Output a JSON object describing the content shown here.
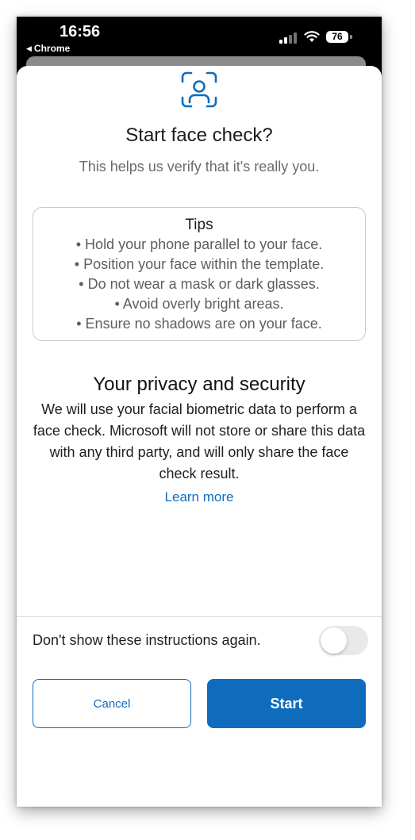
{
  "status_bar": {
    "time": "16:56",
    "back_app": "Chrome",
    "battery": "76",
    "icons": [
      "signal-icon",
      "wifi-icon",
      "battery-icon"
    ]
  },
  "dialog": {
    "icon": "face-scan-icon",
    "title": "Start face check?",
    "subtitle": "This helps us verify that it's really you.",
    "tips": {
      "title": "Tips",
      "items": [
        "• Hold your phone parallel to your face.",
        "• Position your face within the template.",
        "• Do not wear a mask or dark glasses.",
        "• Avoid overly bright areas.",
        "• Ensure no shadows are on your face."
      ]
    },
    "privacy": {
      "title": "Your privacy and security",
      "body": "We will use your facial biometric data to perform a face check. Microsoft will not store or share this data with any third party, and will only share the face check result.",
      "link": "Learn more"
    },
    "toggle": {
      "label": "Don't show these instructions again.",
      "on": false
    },
    "buttons": {
      "cancel": "Cancel",
      "start": "Start"
    }
  },
  "colors": {
    "accent": "#0f6cbd",
    "toggle_off": "#e9e9ea",
    "text_secondary": "#6b6b6b"
  }
}
